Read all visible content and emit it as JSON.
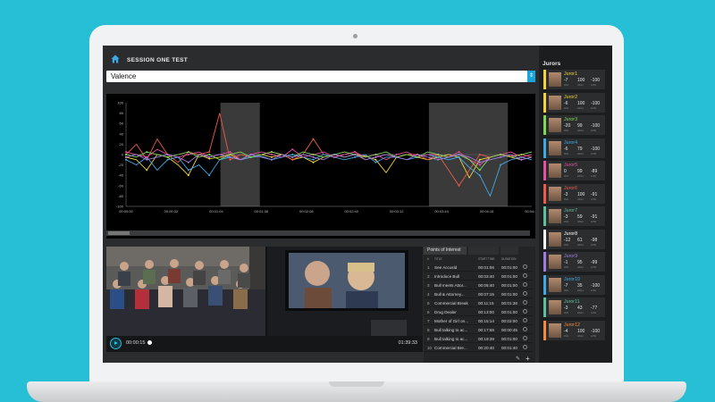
{
  "session": {
    "title": "SESSION ONE TEST"
  },
  "metric_select": {
    "value": "Valence"
  },
  "chart_data": {
    "type": "line",
    "ylim": [
      -100,
      100
    ],
    "yticks": [
      "100",
      "80",
      "60",
      "40",
      "20",
      "0",
      "-20",
      "-40",
      "-60",
      "-80",
      "-100"
    ],
    "xticks": [
      "00:00:00",
      "00:00:32",
      "00:01:04",
      "00:01:36",
      "00:02:08",
      "00:02:40",
      "00:03:12",
      "00:03:44",
      "00:04:16",
      "00:04:48"
    ],
    "xmax_seconds": 288,
    "highlight_ranges": [
      [
        67,
        95
      ],
      [
        215,
        271
      ]
    ],
    "series": [
      {
        "color": "#f3d23c",
        "values": [
          -5,
          -10,
          -30,
          0,
          -5,
          -20,
          -40,
          0,
          -8,
          -5,
          0,
          -10,
          -5,
          0,
          -5,
          0,
          -10,
          -5,
          -15,
          -5,
          0,
          -5,
          0,
          -3,
          -10,
          -35,
          -5,
          0,
          -5,
          -10,
          -5,
          0,
          -5,
          -45,
          -10,
          -5,
          0,
          -5,
          -10,
          -5
        ]
      },
      {
        "color": "#ef5a4a",
        "values": [
          0,
          20,
          -10,
          30,
          0,
          -15,
          5,
          0,
          5,
          80,
          -10,
          0,
          -5,
          0,
          5,
          0,
          -10,
          0,
          30,
          0,
          -5,
          0,
          5,
          -10,
          -5,
          0,
          -5,
          0,
          0,
          -10,
          0,
          -30,
          -60,
          -30,
          0,
          -5,
          0,
          -3,
          0,
          -5
        ]
      },
      {
        "color": "#3fa9e6",
        "values": [
          -10,
          -20,
          -5,
          -30,
          -10,
          -5,
          -30,
          -20,
          -40,
          -10,
          -5,
          -10,
          -5,
          -3,
          -10,
          -5,
          0,
          -5,
          -10,
          0,
          -5,
          -10,
          -5,
          0,
          -15,
          -5,
          -5,
          -10,
          -5,
          0,
          -5,
          -10,
          -5,
          -25,
          -40,
          -80,
          -20,
          -10,
          -5,
          -10
        ]
      },
      {
        "color": "#e74fa0",
        "values": [
          5,
          0,
          -5,
          10,
          0,
          -5,
          0,
          5,
          -5,
          0,
          5,
          -10,
          0,
          5,
          0,
          -5,
          10,
          -5,
          0,
          5,
          -5,
          0,
          5,
          -5,
          0,
          -10,
          0,
          5,
          -5,
          0,
          0,
          -5,
          5,
          -10,
          -20,
          -5,
          0,
          5,
          -5,
          0
        ]
      },
      {
        "color": "#7ed957",
        "values": [
          0,
          -5,
          5,
          0,
          -5,
          0,
          5,
          -5,
          0,
          -10,
          0,
          5,
          -5,
          0,
          5,
          0,
          -5,
          5,
          0,
          -5,
          0,
          5,
          0,
          -5,
          0,
          5,
          -5,
          0,
          -5,
          5,
          0,
          -5,
          0,
          -10,
          -30,
          -5,
          0,
          -5,
          0,
          5
        ]
      },
      {
        "color": "#a07be0",
        "values": [
          -5,
          0,
          -10,
          -5,
          0,
          -5,
          -15,
          0,
          -5,
          0,
          -5,
          -10,
          0,
          -5,
          -10,
          0,
          -5,
          0,
          -5,
          -10,
          0,
          -5,
          0,
          -10,
          -5,
          0,
          -5,
          -10,
          0,
          -5,
          -10,
          -5,
          0,
          -5,
          -15,
          -10,
          -5,
          0,
          -10,
          -5
        ]
      }
    ]
  },
  "video": {
    "current_time": "00:00:15",
    "total_time": "01:39:33"
  },
  "poi": {
    "tab_label": "Points of Interest",
    "headers": {
      "num": "#",
      "title": "TITLE",
      "start": "START TIME",
      "duration": "DURATION"
    },
    "rows": [
      {
        "num": "1",
        "title": "See Accusld",
        "start": "00:01:06",
        "duration": "00:01:00"
      },
      {
        "num": "2",
        "title": "Introduce Bull",
        "start": "00:03:40",
        "duration": "00:01:00"
      },
      {
        "num": "3",
        "title": "Bull meets Attor...",
        "start": "00:05:40",
        "duration": "00:01:00"
      },
      {
        "num": "4",
        "title": "Bull & Attorney...",
        "start": "00:07:15",
        "duration": "00:01:00"
      },
      {
        "num": "5",
        "title": "Commercial Break",
        "start": "00:11:15",
        "duration": "00:01:36"
      },
      {
        "num": "6",
        "title": "Drug Dealer",
        "start": "00:13:00",
        "duration": "00:01:00"
      },
      {
        "num": "7",
        "title": "Mother of Girl on...",
        "start": "00:15:14",
        "duration": "00:02:00"
      },
      {
        "num": "8",
        "title": "Bull talking to ac...",
        "start": "00:17:58",
        "duration": "00:00:45"
      },
      {
        "num": "9",
        "title": "Bull talking to ac...",
        "start": "00:19:39",
        "duration": "00:01:00"
      },
      {
        "num": "10",
        "title": "Commercial Bre...",
        "start": "00:20:40",
        "duration": "00:01:40"
      }
    ]
  },
  "jurors": {
    "title": "Jurors",
    "stat_labels": {
      "avg": "AVG",
      "high": "HIGH",
      "low": "LOW"
    },
    "items": [
      {
        "name": "Juror1",
        "avg": "-7",
        "high": "100",
        "low": "-100",
        "color": "#f3d23c"
      },
      {
        "name": "Juror2",
        "avg": "-6",
        "high": "100",
        "low": "-100",
        "color": "#f3d23c"
      },
      {
        "name": "Juror3",
        "avg": "-20",
        "high": "99",
        "low": "-100",
        "color": "#7ed957"
      },
      {
        "name": "Juror4",
        "avg": "-6",
        "high": "79",
        "low": "-100",
        "color": "#3fa9e6"
      },
      {
        "name": "Juror5",
        "avg": "0",
        "high": "99",
        "low": "-89",
        "color": "#e74fa0"
      },
      {
        "name": "Juror6",
        "avg": "-3",
        "high": "100",
        "low": "-91",
        "color": "#ef5a4a"
      },
      {
        "name": "Juror7",
        "avg": "-3",
        "high": "59",
        "low": "-91",
        "color": "#5fbf9a"
      },
      {
        "name": "Juror8",
        "avg": "-12",
        "high": "61",
        "low": "-98",
        "color": "#ffffff"
      },
      {
        "name": "Juror9",
        "avg": "-1",
        "high": "95",
        "low": "-99",
        "color": "#a07be0"
      },
      {
        "name": "Juror10",
        "avg": "-7",
        "high": "35",
        "low": "-100",
        "color": "#3fa9e6"
      },
      {
        "name": "Juror11",
        "avg": "-3",
        "high": "43",
        "low": "-77",
        "color": "#5fbf9a"
      },
      {
        "name": "Juror12",
        "avg": "-4",
        "high": "100",
        "low": "-100",
        "color": "#f38a3c"
      }
    ]
  }
}
